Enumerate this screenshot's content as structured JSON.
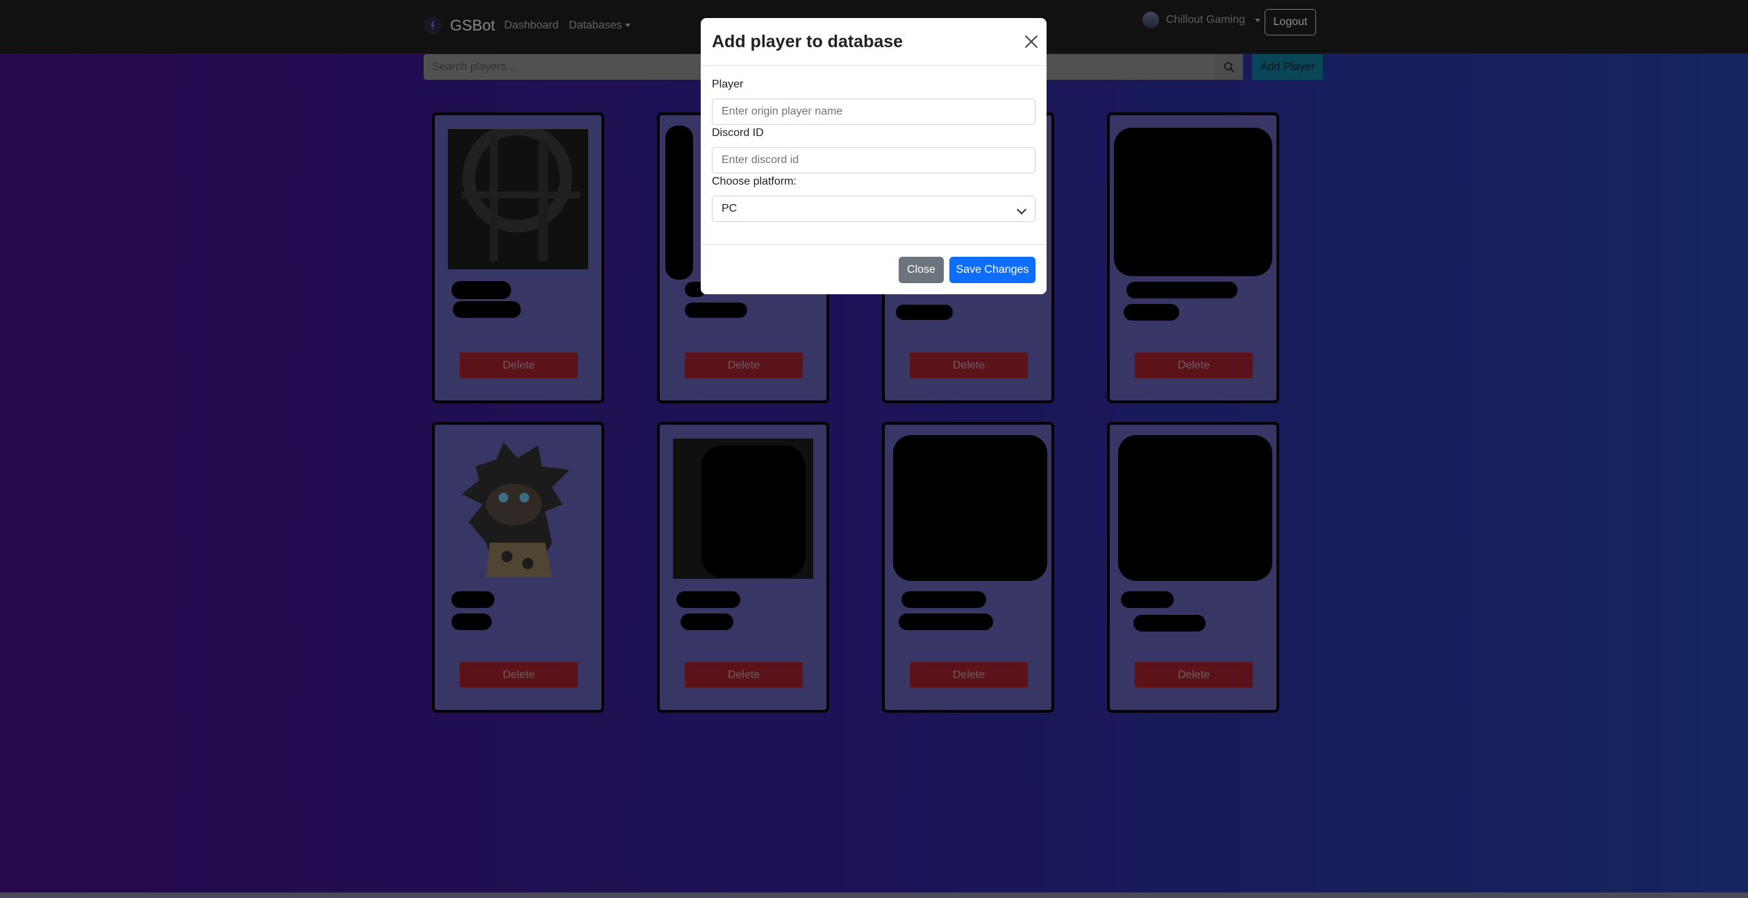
{
  "navbar": {
    "brand": "GSBot",
    "links": [
      "Dashboard",
      "Databases"
    ],
    "guild": "Chillout Gaming",
    "logout": "Logout"
  },
  "search": {
    "placeholder": "Search players..."
  },
  "add_player_label": "Add Player",
  "cards": [
    {
      "delete": "Delete"
    },
    {
      "delete": "Delete"
    },
    {
      "delete": "Delete"
    },
    {
      "delete": "Delete"
    },
    {
      "delete": "Delete"
    },
    {
      "delete": "Delete"
    },
    {
      "delete": "Delete"
    },
    {
      "delete": "Delete"
    }
  ],
  "modal": {
    "title": "Add player to database",
    "player_label": "Player",
    "player_placeholder": "Enter origin player name",
    "discord_label": "Discord ID",
    "discord_placeholder": "Enter discord id",
    "platform_label": "Choose platform:",
    "platform_value": "PC",
    "close_label": "Close",
    "save_label": "Save Changes"
  },
  "colors": {
    "delete": "#dc3545",
    "primary": "#0d6efd",
    "secondary": "#6c757d",
    "info": "#0dcaf0"
  }
}
